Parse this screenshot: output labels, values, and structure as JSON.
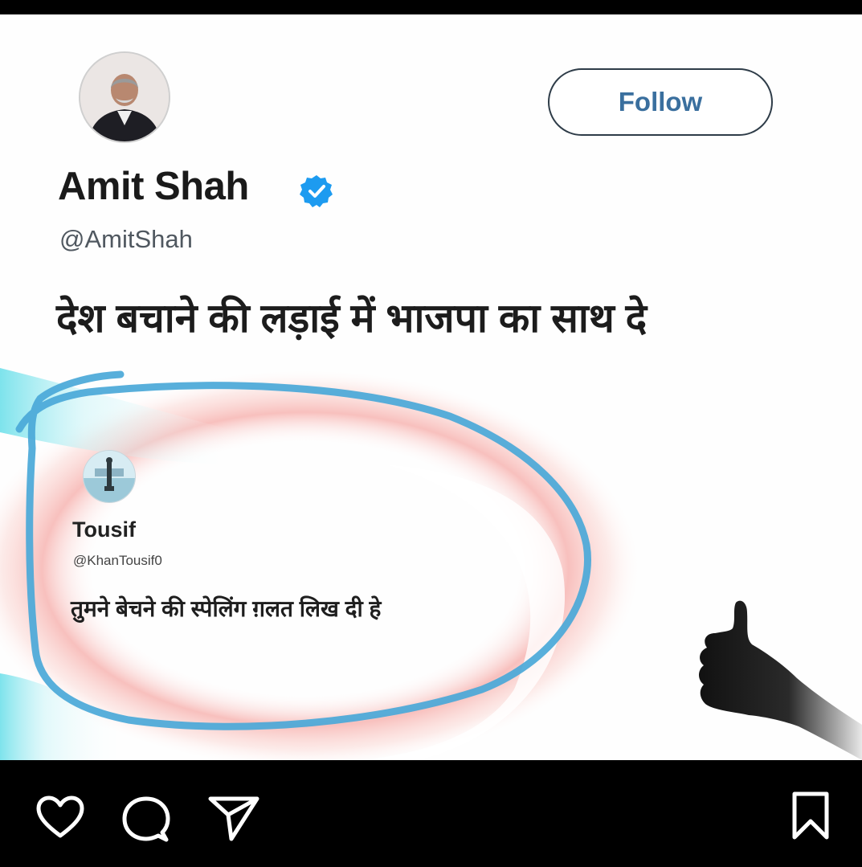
{
  "tweet": {
    "author_name": "Amit Shah",
    "author_handle": "@AmitShah",
    "follow_label": "Follow",
    "text": "देश बचाने की लड़ाई में भाजपा का साथ दे"
  },
  "reply": {
    "author_name": "Tousif",
    "author_handle": "@KhanTousif0",
    "text": "तुमने बेचने की स्पेलिंग ग़लत लिख दी हे"
  },
  "colors": {
    "verified_badge": "#1d9bf0",
    "scribble": "#4aa8d8",
    "glow_pink": "#f4a0a0",
    "glow_cyan": "#7fe0ea",
    "follow_text": "#3a6f9e"
  },
  "actions": {
    "icons": [
      "heart-icon",
      "comment-icon",
      "share-icon",
      "bookmark-icon"
    ]
  }
}
